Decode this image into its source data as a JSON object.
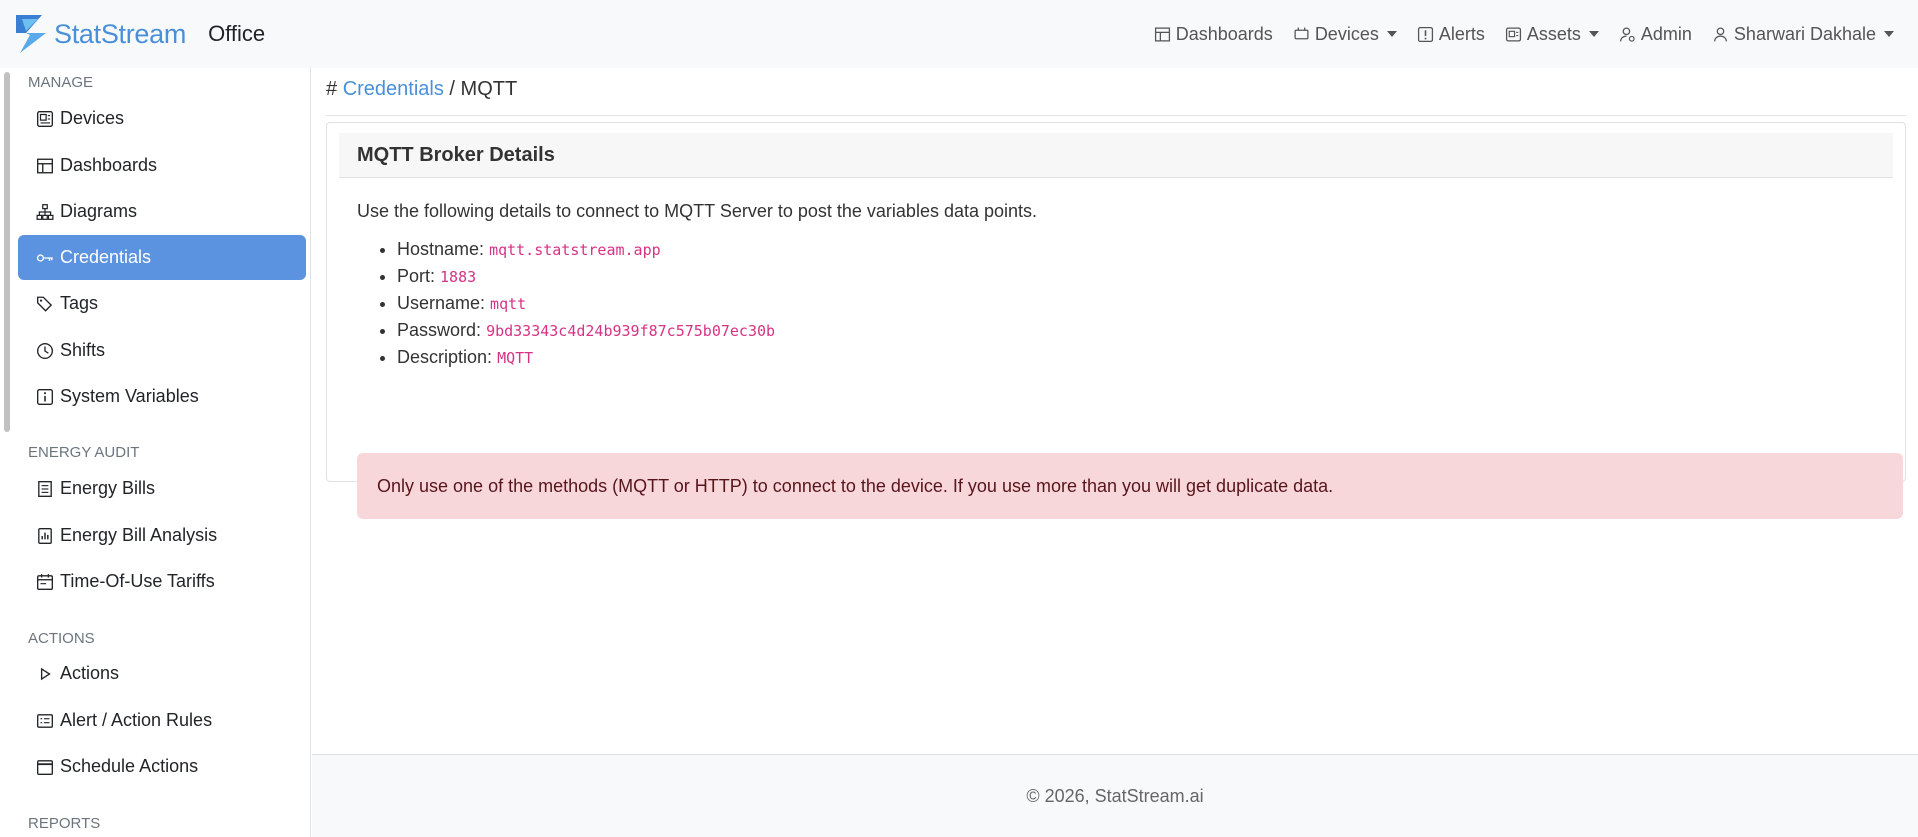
{
  "header": {
    "brand_name": "StatStream",
    "org_name": "Office",
    "nav": [
      {
        "label": "Dashboards"
      },
      {
        "label": "Devices"
      },
      {
        "label": "Alerts"
      },
      {
        "label": "Assets"
      },
      {
        "label": "Admin"
      },
      {
        "label": "Sharwari Dakhale"
      }
    ]
  },
  "sidebar": {
    "sections": [
      "MANAGE",
      "ENERGY AUDIT",
      "ACTIONS",
      "REPORTS"
    ],
    "items": [
      {
        "label": "Devices"
      },
      {
        "label": "Dashboards"
      },
      {
        "label": "Diagrams"
      },
      {
        "label": "Credentials"
      },
      {
        "label": "Tags"
      },
      {
        "label": "Shifts"
      },
      {
        "label": "System Variables"
      },
      {
        "label": "Energy Bills"
      },
      {
        "label": "Energy Bill Analysis"
      },
      {
        "label": "Time-Of-Use Tariffs"
      },
      {
        "label": "Actions"
      },
      {
        "label": "Alert / Action Rules"
      },
      {
        "label": "Schedule Actions"
      }
    ]
  },
  "breadcrumb": {
    "prefix": "#",
    "link": "Credentials",
    "separator": "/",
    "current": "MQTT"
  },
  "card": {
    "title": "MQTT Broker Details",
    "intro": "Use the following details to connect to MQTT Server to post the variables data points.",
    "details": [
      {
        "label": "Hostname:",
        "value": "mqtt.statstream.app"
      },
      {
        "label": "Port:",
        "value": "1883"
      },
      {
        "label": "Username:",
        "value": "mqtt"
      },
      {
        "label": "Password:",
        "value": "9bd33343c4d24b939f87c575b07ec30b"
      },
      {
        "label": "Description:",
        "value": "MQTT"
      }
    ],
    "alert": "Only use one of the methods (MQTT or HTTP) to connect to the device. If you use more than you will get duplicate data."
  },
  "footer": {
    "text": "© 2026, StatStream.ai"
  }
}
